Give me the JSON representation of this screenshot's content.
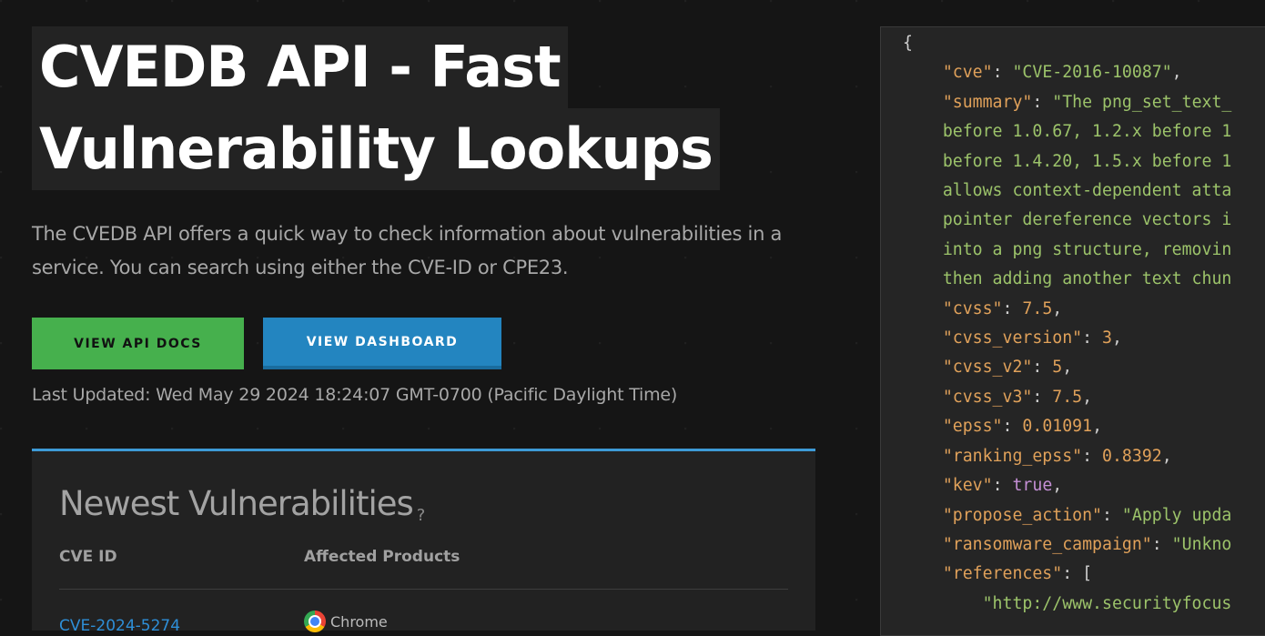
{
  "hero": {
    "title_line1": "CVEDB API - Fast",
    "title_line2": "Vulnerability Lookups",
    "description": "The CVEDB API offers a quick way to check information about vulnerabilities in a service. You can search using either the CVE-ID or CPE23.",
    "docs_button": "VIEW API DOCS",
    "dashboard_button": "VIEW DASHBOARD",
    "last_updated": "Last Updated: Wed May 29 2024 18:24:07 GMT-0700 (Pacific Daylight Time)"
  },
  "newest": {
    "title": "Newest Vulnerabilities",
    "help": "?",
    "columns": [
      "CVE ID",
      "Affected Products"
    ],
    "rows": [
      {
        "cve": "CVE-2024-5274",
        "product": "Chrome"
      }
    ]
  },
  "code_sample": {
    "open_brace": "{",
    "fields": [
      {
        "key": "\"cve\"",
        "value": "\"CVE-2016-10087\""
      },
      {
        "key": "\"summary\"",
        "value": "\"The png_set_text_"
      },
      {
        "cont": "before 1.0.67, 1.2.x before 1"
      },
      {
        "cont": "before 1.4.20, 1.5.x before 1"
      },
      {
        "cont": "allows context-dependent atta"
      },
      {
        "cont": "pointer dereference vectors i"
      },
      {
        "cont": "into a png structure, removin"
      },
      {
        "cont": "then adding another text chun"
      },
      {
        "key": "\"cvss\"",
        "value": "7.5"
      },
      {
        "key": "\"cvss_version\"",
        "value": "3"
      },
      {
        "key": "\"cvss_v2\"",
        "value": "5"
      },
      {
        "key": "\"cvss_v3\"",
        "value": "7.5"
      },
      {
        "key": "\"epss\"",
        "value": "0.01091"
      },
      {
        "key": "\"ranking_epss\"",
        "value": "0.8392"
      },
      {
        "key": "\"kev\"",
        "value": "true"
      },
      {
        "key": "\"propose_action\"",
        "value": "\"Apply upda"
      },
      {
        "key": "\"ransomware_campaign\"",
        "value": "\"Unkno"
      },
      {
        "key": "\"references\"",
        "value": "["
      },
      {
        "ref": "\"http://www.securityfocus"
      }
    ]
  },
  "colors": {
    "background": "#151515",
    "green_button": "#46b04d",
    "blue_button": "#2385c0",
    "panel_accent": "#3d9ad6",
    "link": "#2e8fd8"
  }
}
